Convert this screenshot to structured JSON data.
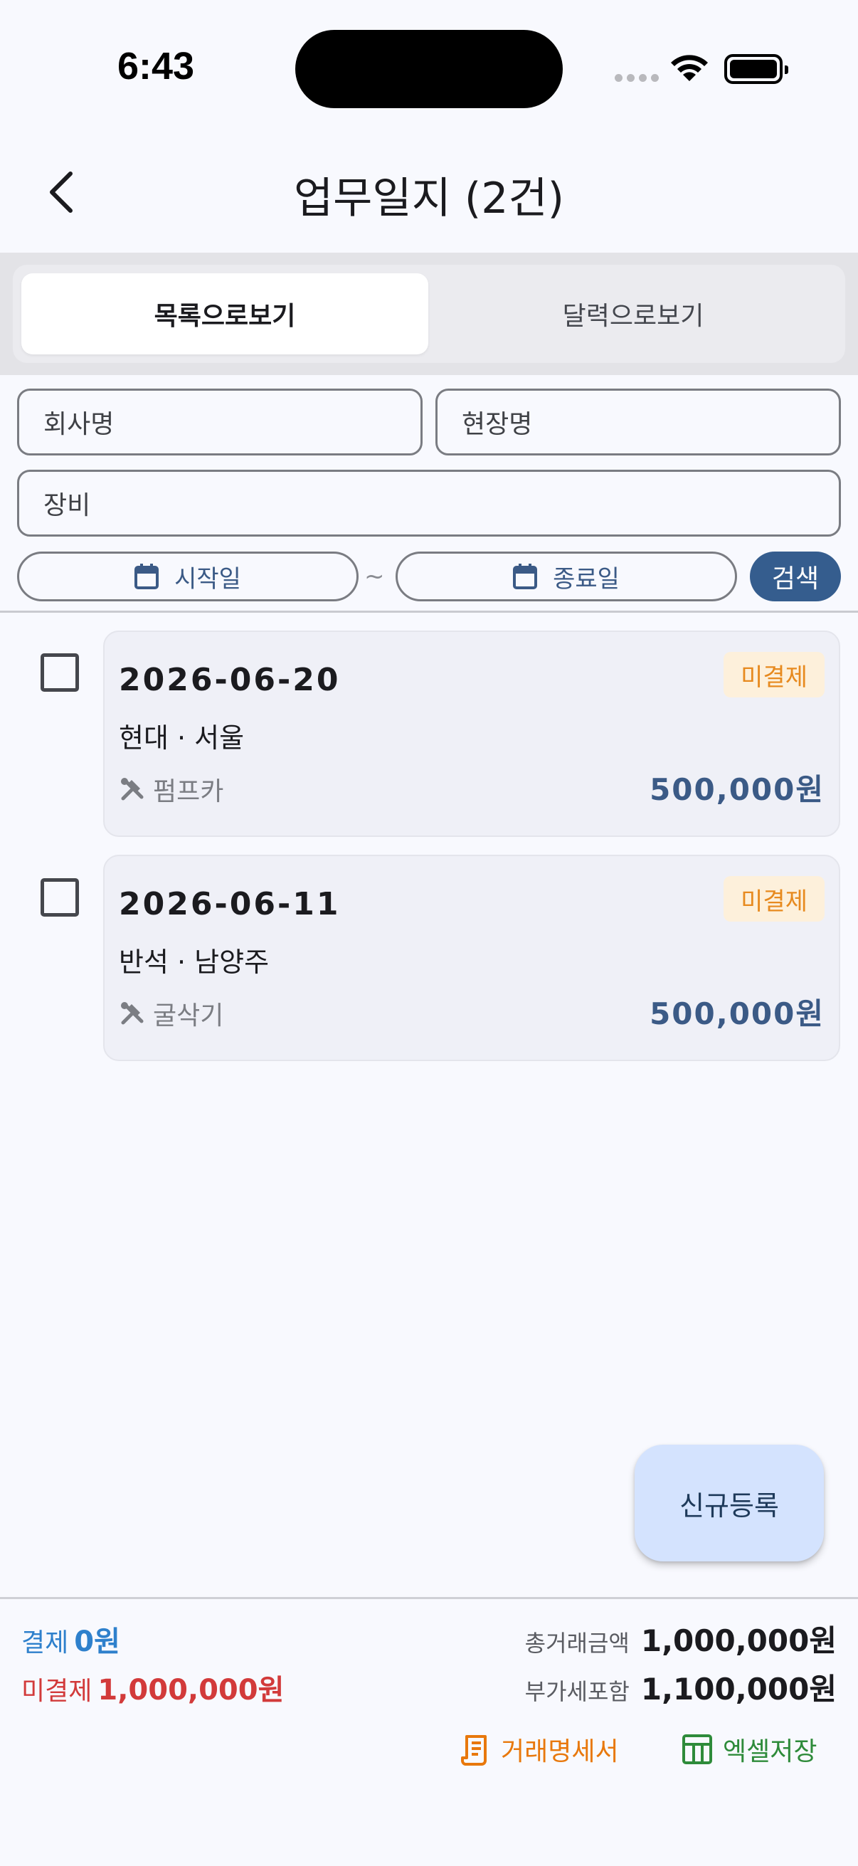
{
  "status_bar": {
    "time": "6:43"
  },
  "header": {
    "title": "업무일지 (2건)"
  },
  "view_toggle": {
    "list_label": "목록으로보기",
    "calendar_label": "달력으로보기"
  },
  "filters": {
    "company_placeholder": "회사명",
    "site_placeholder": "현장명",
    "equipment_placeholder": "장비",
    "start_date_placeholder": "시작일",
    "end_date_placeholder": "종료일",
    "separator": "~",
    "search_label": "검색"
  },
  "records": [
    {
      "date": "2026-06-20",
      "status": "미결제",
      "location": "현대 · 서울",
      "equipment": "펌프카",
      "amount": "500,000원"
    },
    {
      "date": "2026-06-11",
      "status": "미결제",
      "location": "반석 · 남양주",
      "equipment": "굴삭기",
      "amount": "500,000원"
    }
  ],
  "fab": {
    "label": "신규등록"
  },
  "summary": {
    "paid_label": "결제",
    "paid_value": "0원",
    "unpaid_label": "미결제",
    "unpaid_value": "1,000,000원",
    "total_label": "총거래금액",
    "total_value": "1,000,000원",
    "vat_label": "부가세포함",
    "vat_value": "1,100,000원"
  },
  "actions": {
    "statement_label": "거래명세서",
    "excel_label": "엑셀저장"
  },
  "colors": {
    "accent": "#355d8e",
    "unpaid_badge_text": "#e78a1f",
    "unpaid_badge_bg": "#fdf0db",
    "paid_text": "#2e80cc",
    "unpaid_text": "#d23a3a",
    "statement_orange": "#e8780c",
    "excel_green": "#2e8b3a"
  }
}
